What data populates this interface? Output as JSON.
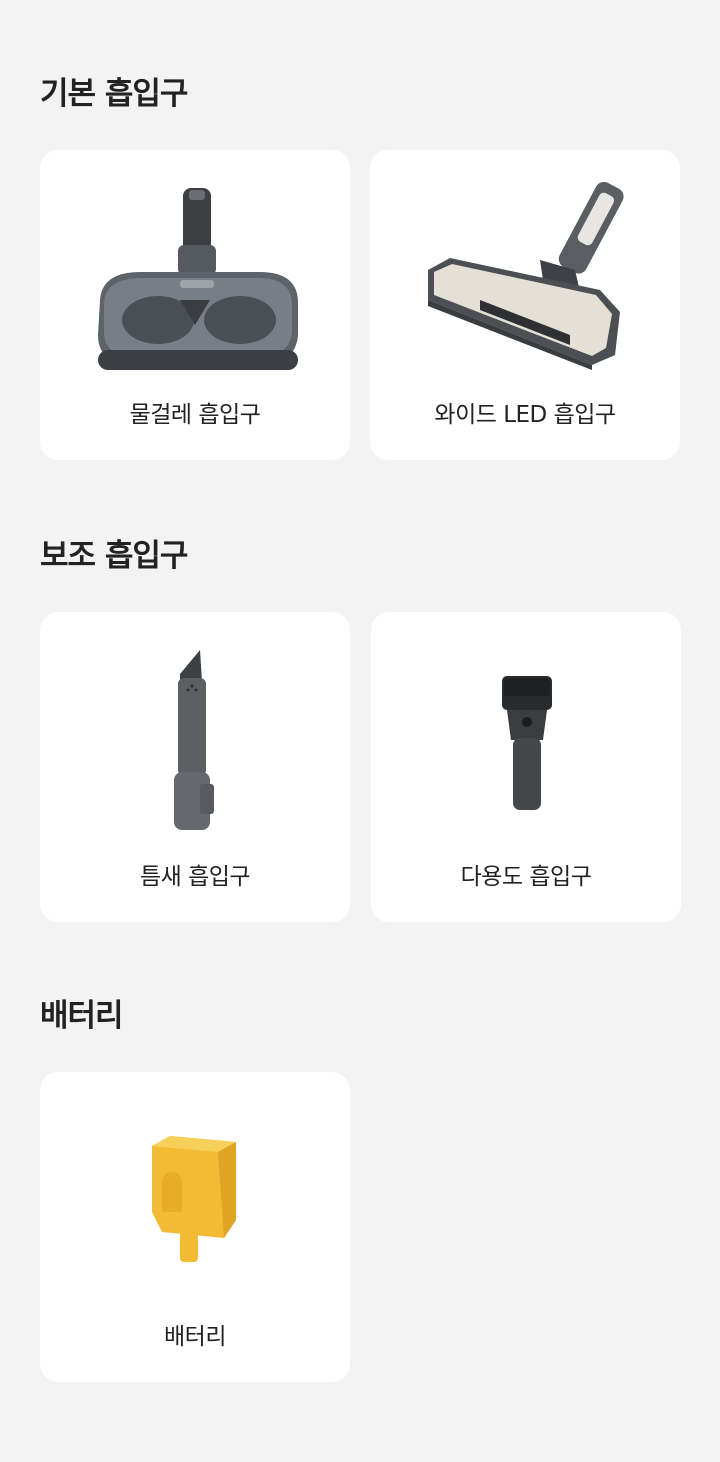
{
  "sections": [
    {
      "title": "기본 흡입구",
      "items": [
        {
          "label": "물걸레 흡입구",
          "icon": "mop-nozzle-icon"
        },
        {
          "label": "와이드 LED 흡입구",
          "icon": "wide-led-nozzle-icon"
        }
      ]
    },
    {
      "title": "보조 흡입구",
      "items": [
        {
          "label": "틈새 흡입구",
          "icon": "crevice-nozzle-icon"
        },
        {
          "label": "다용도 흡입구",
          "icon": "multi-purpose-nozzle-icon"
        }
      ]
    },
    {
      "title": "배터리",
      "items": [
        {
          "label": "배터리",
          "icon": "battery-icon"
        }
      ]
    }
  ],
  "colors": {
    "background": "#f3f3f3",
    "card": "#ffffff",
    "text": "#222222",
    "nozzle_dark": "#4b4e53",
    "wide_plate": "#e6dfd6",
    "battery_yellow": "#f2bb33"
  }
}
